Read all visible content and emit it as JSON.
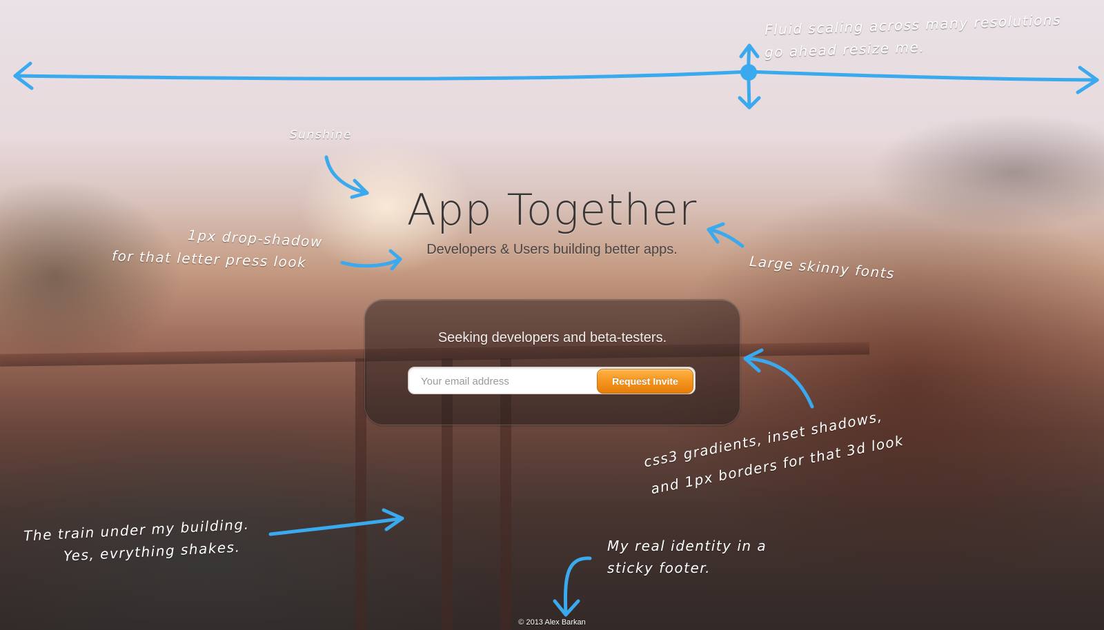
{
  "hero": {
    "title": "App Together",
    "subtitle": "Developers & Users building better apps."
  },
  "signup": {
    "heading": "Seeking developers and beta-testers.",
    "email_placeholder": "Your email address",
    "button_label": "Request Invite"
  },
  "annotations": {
    "fluid_line1": "Fluid scaling across many resolutions",
    "fluid_line2": "go ahead resize me.",
    "sunshine": "Sunshine",
    "dropshadow_line1": "1px drop-shadow",
    "dropshadow_line2": "for that letter press look",
    "skinny_fonts": "Large skinny fonts",
    "css3_line1": "css3 gradients, inset shadows,",
    "css3_line2": "and 1px borders for that 3d look",
    "train_line1": "The train under my building.",
    "train_line2": "Yes, evrything shakes.",
    "footer_line1": "My real identity in a",
    "footer_line2": "sticky footer."
  },
  "footer": {
    "copyright": "© 2013 Alex Barkan"
  },
  "colors": {
    "annotation_arrow": "#3aa9ee",
    "button_orange": "#f5951f",
    "title_text": "#3a3636"
  },
  "icons": {
    "arrow": "hand-drawn-arrow"
  }
}
